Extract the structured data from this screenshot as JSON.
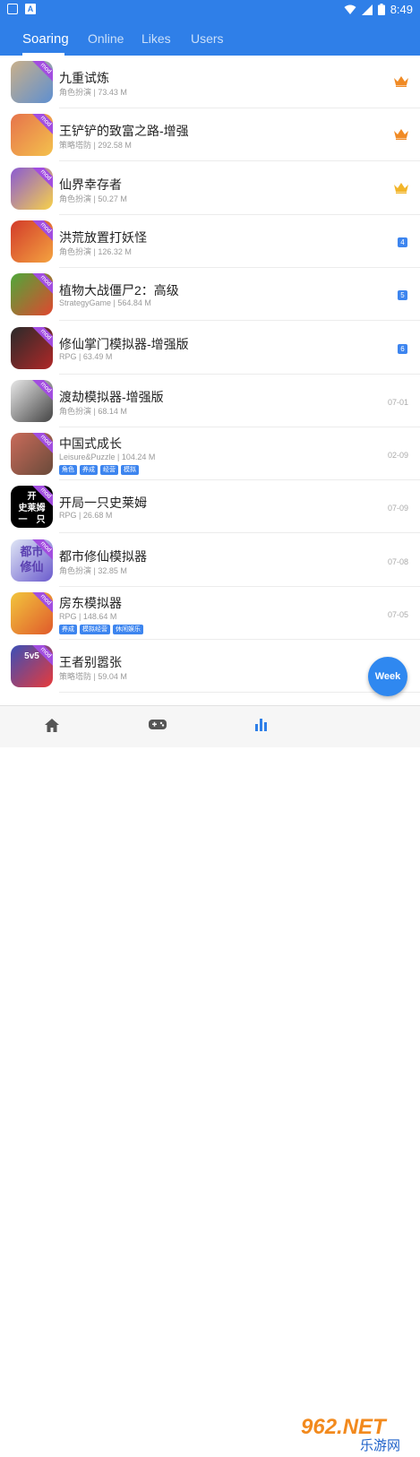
{
  "status_bar": {
    "time": "8:49"
  },
  "tabs": [
    {
      "label": "Soaring",
      "active": true
    },
    {
      "label": "Online",
      "active": false
    },
    {
      "label": "Likes",
      "active": false
    },
    {
      "label": "Users",
      "active": false
    }
  ],
  "apps": [
    {
      "title": "九重试炼",
      "meta": "角色扮演 | 73.43 M",
      "badge_type": "crown",
      "crown_color": "#f08a24",
      "icon_colors": [
        "#c9b08a",
        "#5e8fd0"
      ]
    },
    {
      "title": "王铲铲的致富之路-增强",
      "meta": "策略塔防 | 292.58 M",
      "badge_type": "crown",
      "crown_color": "#f08a24",
      "icon_colors": [
        "#e6734b",
        "#f4c14d"
      ]
    },
    {
      "title": "仙界幸存者",
      "meta": "角色扮演 | 50.27 M",
      "badge_type": "crown",
      "crown_color": "#f2b52a",
      "icon_colors": [
        "#8a5ad3",
        "#f7d14a"
      ]
    },
    {
      "title": "洪荒放置打妖怪",
      "meta": "角色扮演 | 126.32 M",
      "badge_type": "rank",
      "rank": "4",
      "icon_colors": [
        "#d23b2a",
        "#f4a340"
      ]
    },
    {
      "title": "植物大战僵尸2：高级",
      "meta": "StrategyGame | 564.84 M",
      "badge_type": "rank",
      "rank": "5",
      "icon_colors": [
        "#4fa83a",
        "#e0472f"
      ]
    },
    {
      "title": "修仙掌门模拟器-增强版",
      "meta": "RPG | 63.49 M",
      "badge_type": "rank",
      "rank": "6",
      "icon_colors": [
        "#2a2a2a",
        "#b02828"
      ]
    },
    {
      "title": "渡劫模拟器-增强版",
      "meta": "角色扮演 | 68.14 M",
      "badge_type": "date",
      "date": "07-01",
      "icon_colors": [
        "#e8e8e8",
        "#444444"
      ]
    },
    {
      "title": "中国式成长",
      "meta": "Leisure&Puzzle | 104.24 M",
      "badge_type": "date",
      "date": "02-09",
      "tags": [
        "角色",
        "养成",
        "经营",
        "模拟"
      ],
      "icon_colors": [
        "#c96b5a",
        "#6a4a3a"
      ]
    },
    {
      "title": "开局一只史莱姆",
      "meta": "RPG | 26.68 M",
      "badge_type": "date",
      "date": "07-09",
      "icon_colors": [
        "#000000",
        "#000000"
      ],
      "icon_text": "开\n史莱姆\n一　只"
    },
    {
      "title": "都市修仙模拟器",
      "meta": "角色扮演 | 32.85 M",
      "badge_type": "date",
      "date": "07-08",
      "icon_colors": [
        "#dfe6f5",
        "#6a5acd"
      ],
      "icon_text": "都市\n修仙"
    },
    {
      "title": "房东模拟器",
      "meta": "RPG | 148.64 M",
      "badge_type": "date",
      "date": "07-05",
      "tags": [
        "养成",
        "模拟经营",
        "休闲娱乐"
      ],
      "icon_colors": [
        "#f2c53d",
        "#e05a2b"
      ]
    },
    {
      "title": "王者别嚣张",
      "meta": "策略塔防 | 59.04 M",
      "badge_type": "none",
      "icon_colors": [
        "#3a4fb8",
        "#e83a3a"
      ],
      "icon_text": "5v5"
    }
  ],
  "mod_label": "mod",
  "fab": {
    "label": "Week"
  },
  "bottom_nav": [
    {
      "icon": "home-icon",
      "active": false
    },
    {
      "icon": "gamepad-icon",
      "active": false
    },
    {
      "icon": "bar-chart-icon",
      "active": true
    }
  ],
  "watermark": {
    "main": "962.NET",
    "sub": "乐游网"
  },
  "accent_color": "#2f7fe8"
}
